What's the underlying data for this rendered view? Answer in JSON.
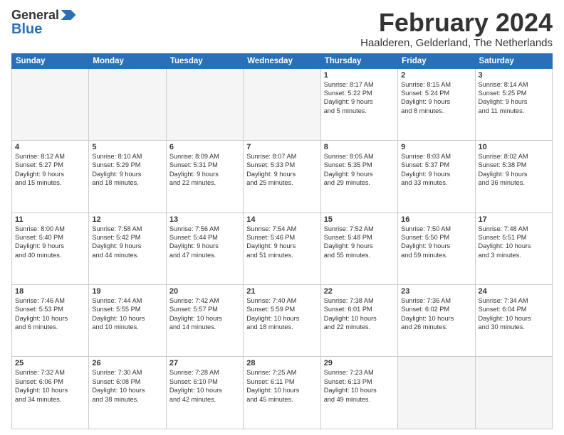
{
  "header": {
    "logo_line1": "General",
    "logo_line2": "Blue",
    "month_year": "February 2024",
    "location": "Haalderen, Gelderland, The Netherlands"
  },
  "days_of_week": [
    "Sunday",
    "Monday",
    "Tuesday",
    "Wednesday",
    "Thursday",
    "Friday",
    "Saturday"
  ],
  "weeks": [
    [
      {
        "day": "",
        "text": ""
      },
      {
        "day": "",
        "text": ""
      },
      {
        "day": "",
        "text": ""
      },
      {
        "day": "",
        "text": ""
      },
      {
        "day": "1",
        "text": "Sunrise: 8:17 AM\nSunset: 5:22 PM\nDaylight: 9 hours\nand 5 minutes."
      },
      {
        "day": "2",
        "text": "Sunrise: 8:15 AM\nSunset: 5:24 PM\nDaylight: 9 hours\nand 8 minutes."
      },
      {
        "day": "3",
        "text": "Sunrise: 8:14 AM\nSunset: 5:25 PM\nDaylight: 9 hours\nand 11 minutes."
      }
    ],
    [
      {
        "day": "4",
        "text": "Sunrise: 8:12 AM\nSunset: 5:27 PM\nDaylight: 9 hours\nand 15 minutes."
      },
      {
        "day": "5",
        "text": "Sunrise: 8:10 AM\nSunset: 5:29 PM\nDaylight: 9 hours\nand 18 minutes."
      },
      {
        "day": "6",
        "text": "Sunrise: 8:09 AM\nSunset: 5:31 PM\nDaylight: 9 hours\nand 22 minutes."
      },
      {
        "day": "7",
        "text": "Sunrise: 8:07 AM\nSunset: 5:33 PM\nDaylight: 9 hours\nand 25 minutes."
      },
      {
        "day": "8",
        "text": "Sunrise: 8:05 AM\nSunset: 5:35 PM\nDaylight: 9 hours\nand 29 minutes."
      },
      {
        "day": "9",
        "text": "Sunrise: 8:03 AM\nSunset: 5:37 PM\nDaylight: 9 hours\nand 33 minutes."
      },
      {
        "day": "10",
        "text": "Sunrise: 8:02 AM\nSunset: 5:38 PM\nDaylight: 9 hours\nand 36 minutes."
      }
    ],
    [
      {
        "day": "11",
        "text": "Sunrise: 8:00 AM\nSunset: 5:40 PM\nDaylight: 9 hours\nand 40 minutes."
      },
      {
        "day": "12",
        "text": "Sunrise: 7:58 AM\nSunset: 5:42 PM\nDaylight: 9 hours\nand 44 minutes."
      },
      {
        "day": "13",
        "text": "Sunrise: 7:56 AM\nSunset: 5:44 PM\nDaylight: 9 hours\nand 47 minutes."
      },
      {
        "day": "14",
        "text": "Sunrise: 7:54 AM\nSunset: 5:46 PM\nDaylight: 9 hours\nand 51 minutes."
      },
      {
        "day": "15",
        "text": "Sunrise: 7:52 AM\nSunset: 5:48 PM\nDaylight: 9 hours\nand 55 minutes."
      },
      {
        "day": "16",
        "text": "Sunrise: 7:50 AM\nSunset: 5:50 PM\nDaylight: 9 hours\nand 59 minutes."
      },
      {
        "day": "17",
        "text": "Sunrise: 7:48 AM\nSunset: 5:51 PM\nDaylight: 10 hours\nand 3 minutes."
      }
    ],
    [
      {
        "day": "18",
        "text": "Sunrise: 7:46 AM\nSunset: 5:53 PM\nDaylight: 10 hours\nand 6 minutes."
      },
      {
        "day": "19",
        "text": "Sunrise: 7:44 AM\nSunset: 5:55 PM\nDaylight: 10 hours\nand 10 minutes."
      },
      {
        "day": "20",
        "text": "Sunrise: 7:42 AM\nSunset: 5:57 PM\nDaylight: 10 hours\nand 14 minutes."
      },
      {
        "day": "21",
        "text": "Sunrise: 7:40 AM\nSunset: 5:59 PM\nDaylight: 10 hours\nand 18 minutes."
      },
      {
        "day": "22",
        "text": "Sunrise: 7:38 AM\nSunset: 6:01 PM\nDaylight: 10 hours\nand 22 minutes."
      },
      {
        "day": "23",
        "text": "Sunrise: 7:36 AM\nSunset: 6:02 PM\nDaylight: 10 hours\nand 26 minutes."
      },
      {
        "day": "24",
        "text": "Sunrise: 7:34 AM\nSunset: 6:04 PM\nDaylight: 10 hours\nand 30 minutes."
      }
    ],
    [
      {
        "day": "25",
        "text": "Sunrise: 7:32 AM\nSunset: 6:06 PM\nDaylight: 10 hours\nand 34 minutes."
      },
      {
        "day": "26",
        "text": "Sunrise: 7:30 AM\nSunset: 6:08 PM\nDaylight: 10 hours\nand 38 minutes."
      },
      {
        "day": "27",
        "text": "Sunrise: 7:28 AM\nSunset: 6:10 PM\nDaylight: 10 hours\nand 42 minutes."
      },
      {
        "day": "28",
        "text": "Sunrise: 7:25 AM\nSunset: 6:11 PM\nDaylight: 10 hours\nand 45 minutes."
      },
      {
        "day": "29",
        "text": "Sunrise: 7:23 AM\nSunset: 6:13 PM\nDaylight: 10 hours\nand 49 minutes."
      },
      {
        "day": "",
        "text": ""
      },
      {
        "day": "",
        "text": ""
      }
    ]
  ]
}
